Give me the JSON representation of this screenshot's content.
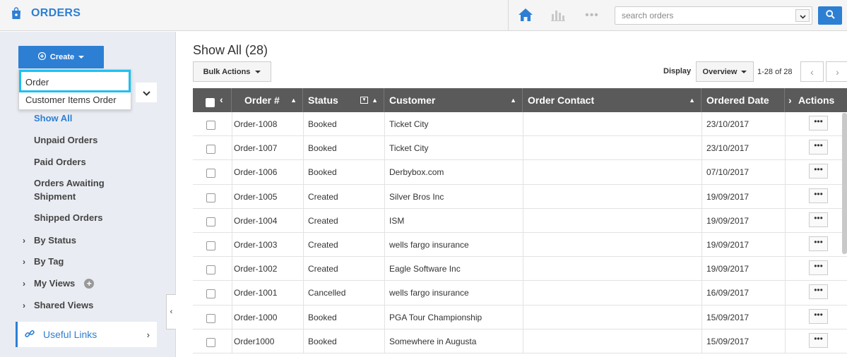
{
  "app": {
    "title": "ORDERS"
  },
  "header": {
    "search_placeholder": "search orders",
    "dots": "•••"
  },
  "sidebar": {
    "create_label": "Create",
    "dropdown": [
      "Order",
      "Customer Items Order"
    ],
    "sub_items": [
      "Show All",
      "Unpaid Orders",
      "Paid Orders",
      "Orders Awaiting Shipment",
      "Shipped Orders"
    ],
    "active_item": "Show All",
    "groups": [
      "By Status",
      "By Tag",
      "My Views",
      "Shared Views"
    ],
    "useful_links": "Useful Links"
  },
  "main": {
    "title": "Show All (28)",
    "bulk_actions": "Bulk Actions",
    "display_label": "Display",
    "display_value": "Overview",
    "pager": "1-28 of 28"
  },
  "table": {
    "columns": [
      "Order #",
      "Status",
      "Customer",
      "Order Contact",
      "Ordered Date",
      "Actions"
    ],
    "rows": [
      [
        "Order-1008",
        "Booked",
        "Ticket City",
        "",
        "23/10/2017"
      ],
      [
        "Order-1007",
        "Booked",
        "Ticket City",
        "",
        "23/10/2017"
      ],
      [
        "Order-1006",
        "Booked",
        "Derbybox.com",
        "",
        "07/10/2017"
      ],
      [
        "Order-1005",
        "Created",
        "Silver Bros Inc",
        "",
        "19/09/2017"
      ],
      [
        "Order-1004",
        "Created",
        "ISM",
        "",
        "19/09/2017"
      ],
      [
        "Order-1003",
        "Created",
        "wells fargo insurance",
        "",
        "19/09/2017"
      ],
      [
        "Order-1002",
        "Created",
        "Eagle Software Inc",
        "",
        "19/09/2017"
      ],
      [
        "Order-1001",
        "Cancelled",
        "wells fargo insurance",
        "",
        "16/09/2017"
      ],
      [
        "Order-1000",
        "Booked",
        "PGA Tour Championship",
        "",
        "15/09/2017"
      ],
      [
        "Order1000",
        "Booked",
        "Somewhere in Augusta",
        "",
        "15/09/2017"
      ]
    ],
    "row_action_label": "•••"
  },
  "colors": {
    "accent": "#2d7fd3",
    "highlight": "#1ec0f2",
    "header_bg": "#5a5a5a",
    "sidebar_bg": "#e9ecf2"
  }
}
